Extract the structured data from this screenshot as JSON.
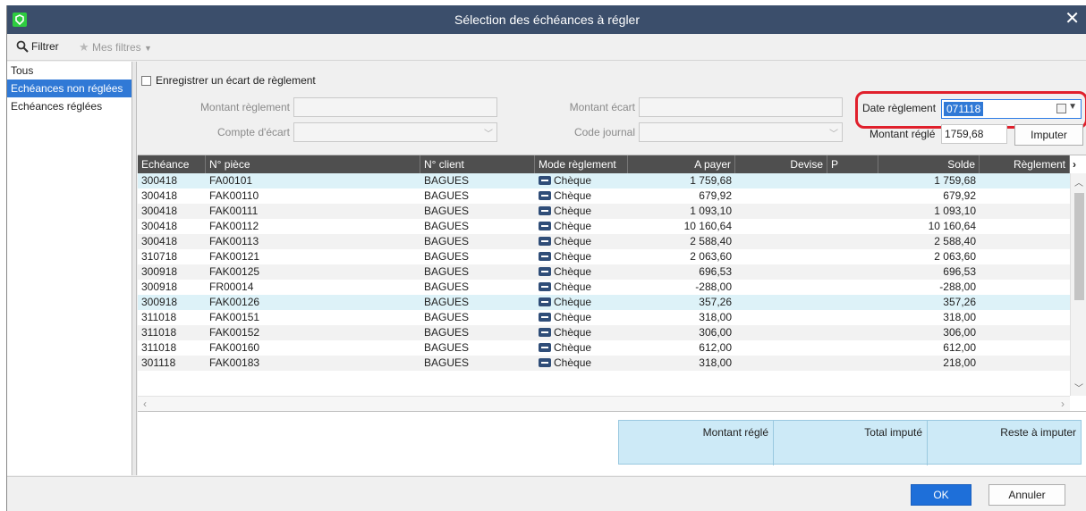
{
  "window": {
    "title": "Sélection des échéances à régler"
  },
  "toolbar": {
    "filter_label": "Filtrer",
    "my_filters_label": "Mes filtres"
  },
  "sidebar": {
    "items": [
      {
        "label": "Tous"
      },
      {
        "label": "Echéances non réglées"
      },
      {
        "label": "Echéances réglées"
      }
    ]
  },
  "form": {
    "register_gap_label": "Enregistrer un écart de règlement",
    "montant_reglement_label": "Montant règlement",
    "montant_reglement_value": "",
    "compte_ecart_label": "Compte d'écart",
    "compte_ecart_value": "",
    "montant_ecart_label": "Montant écart",
    "montant_ecart_value": "",
    "code_journal_label": "Code journal",
    "code_journal_value": "",
    "date_reglement_label": "Date règlement",
    "date_reglement_value": "071118",
    "montant_regle_label": "Montant réglé",
    "montant_regle_value": "1759,68",
    "imputer_label": "Imputer"
  },
  "grid": {
    "columns": [
      "Echéance",
      "N° pièce",
      "N° client",
      "Mode règlement",
      "A payer",
      "Devise",
      "P",
      "Solde",
      "Règlement"
    ],
    "rows": [
      {
        "echeance": "300418",
        "piece": "FA00101",
        "client": "BAGUES",
        "mode": "Chèque",
        "a_payer": "1 759,68",
        "solde": "1 759,68"
      },
      {
        "echeance": "300418",
        "piece": "FAK00110",
        "client": "BAGUES",
        "mode": "Chèque",
        "a_payer": "679,92",
        "solde": "679,92"
      },
      {
        "echeance": "300418",
        "piece": "FAK00111",
        "client": "BAGUES",
        "mode": "Chèque",
        "a_payer": "1 093,10",
        "solde": "1 093,10"
      },
      {
        "echeance": "300418",
        "piece": "FAK00112",
        "client": "BAGUES",
        "mode": "Chèque",
        "a_payer": "10 160,64",
        "solde": "10 160,64"
      },
      {
        "echeance": "300418",
        "piece": "FAK00113",
        "client": "BAGUES",
        "mode": "Chèque",
        "a_payer": "2 588,40",
        "solde": "2 588,40"
      },
      {
        "echeance": "310718",
        "piece": "FAK00121",
        "client": "BAGUES",
        "mode": "Chèque",
        "a_payer": "2 063,60",
        "solde": "2 063,60"
      },
      {
        "echeance": "300918",
        "piece": "FAK00125",
        "client": "BAGUES",
        "mode": "Chèque",
        "a_payer": "696,53",
        "solde": "696,53"
      },
      {
        "echeance": "300918",
        "piece": "FR00014",
        "client": "BAGUES",
        "mode": "Chèque",
        "a_payer": "-288,00",
        "solde": "-288,00"
      },
      {
        "echeance": "300918",
        "piece": "FAK00126",
        "client": "BAGUES",
        "mode": "Chèque",
        "a_payer": "357,26",
        "solde": "357,26"
      },
      {
        "echeance": "311018",
        "piece": "FAK00151",
        "client": "BAGUES",
        "mode": "Chèque",
        "a_payer": "318,00",
        "solde": "318,00"
      },
      {
        "echeance": "311018",
        "piece": "FAK00152",
        "client": "BAGUES",
        "mode": "Chèque",
        "a_payer": "306,00",
        "solde": "306,00"
      },
      {
        "echeance": "311018",
        "piece": "FAK00160",
        "client": "BAGUES",
        "mode": "Chèque",
        "a_payer": "612,00",
        "solde": "612,00"
      },
      {
        "echeance": "301118",
        "piece": "FAK00183",
        "client": "BAGUES",
        "mode": "Chèque",
        "a_payer": "318,00",
        "solde": "218,00"
      }
    ]
  },
  "totals": {
    "montant_regle": "Montant réglé",
    "total_impute": "Total imputé",
    "reste_a_imputer": "Reste à imputer"
  },
  "footer": {
    "ok_label": "OK",
    "cancel_label": "Annuler"
  },
  "icons": {
    "app": "app-logo-icon",
    "close": "close-icon",
    "filter": "search-icon",
    "favorites": "star-icon",
    "calendar": "calendar-icon",
    "payment": "cheque-icon"
  },
  "colors": {
    "titlebar": "#3b4e6b",
    "selection": "#3079d6",
    "highlight_ring": "#e0202c",
    "totals_bg": "#cdeaf7",
    "ok_button": "#1e6fd9"
  }
}
